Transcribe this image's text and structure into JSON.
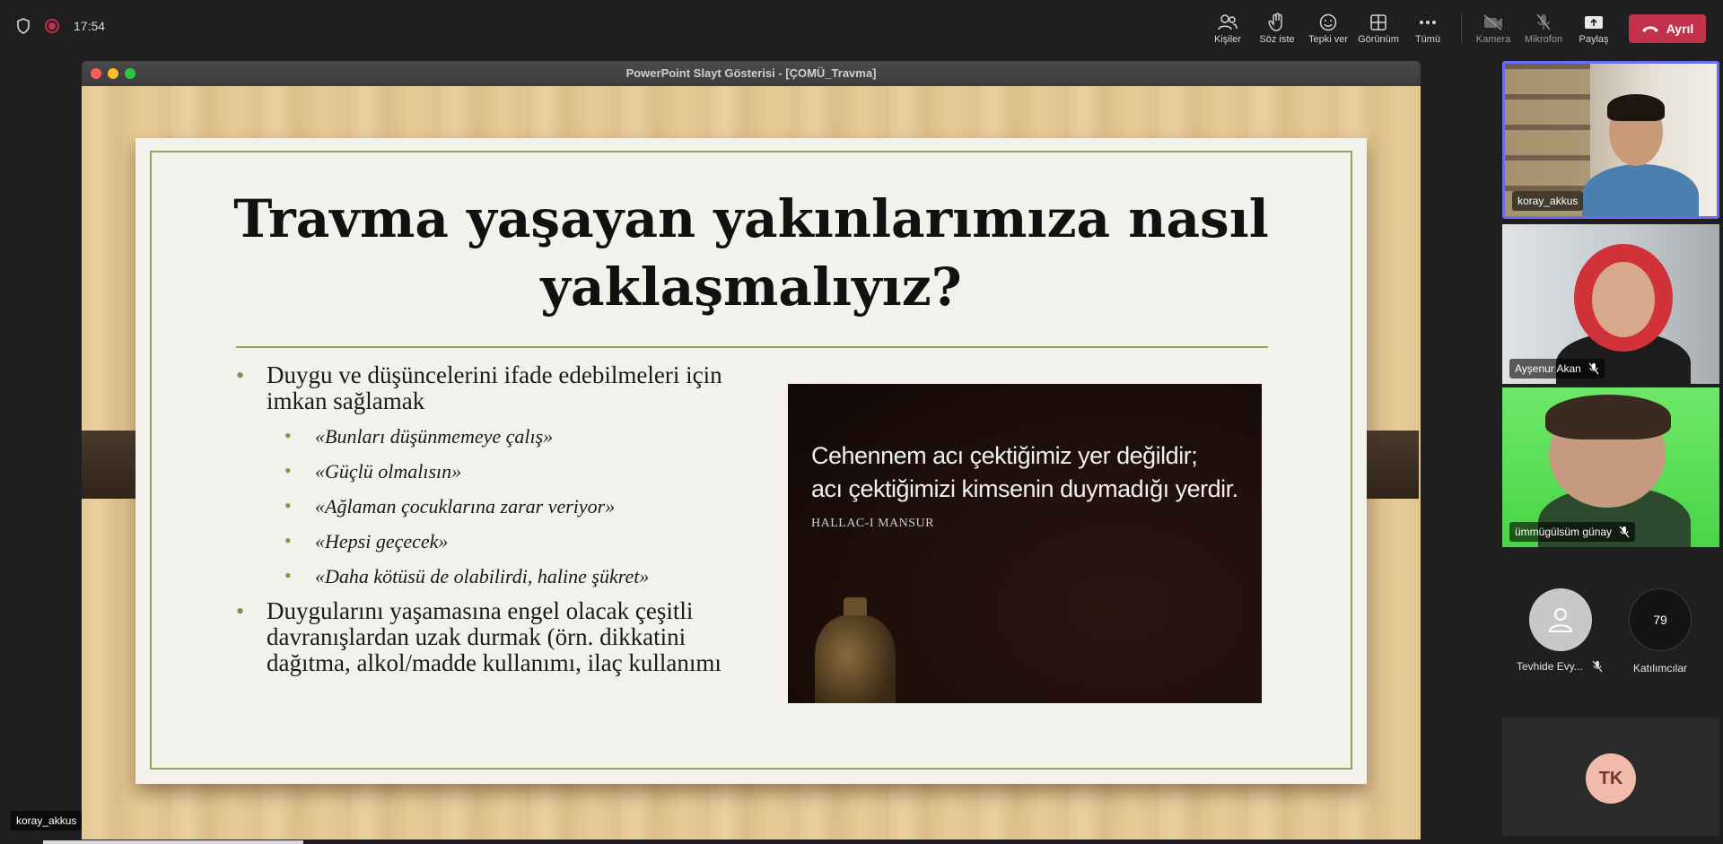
{
  "topbar": {
    "clock": "17:54",
    "buttons": {
      "people": "Kişiler",
      "raise_hand": "Söz iste",
      "react": "Tepki ver",
      "view": "Görünüm",
      "more": "Tümü",
      "camera": "Kamera",
      "mic": "Mikrofon",
      "share": "Paylaş"
    },
    "leave_label": "Ayrıl"
  },
  "shared_window": {
    "title": "PowerPoint Slayt Gösterisi - [ÇOMÜ_Travma]",
    "slide": {
      "title_line1": "Travma yaşayan yakınlarımıza nasıl",
      "title_line2": "yaklaşmalıyız?",
      "bullet1": "Duygu ve düşüncelerini ifade edebilmeleri için imkan sağlamak",
      "sub_bullets": [
        "«Bunları düşünmemeye çalış»",
        "«Güçlü olmalısın»",
        "«Ağlaman çocuklarına zarar veriyor»",
        "«Hepsi geçecek»",
        "«Daha kötüsü de olabilirdi, haline şükret»"
      ],
      "bullet2": "Duygularını yaşamasına engel olacak çeşitli davranışlardan uzak durmak (örn. dikkatini dağıtma, alkol/madde kullanımı, ilaç kullanımı",
      "quote_line1": "Cehennem acı çektiğimiz yer değildir;",
      "quote_line2": "acı çektiğimizi kimsenin duymadığı yerdir.",
      "quote_author": "HALLAC-I MANSUR"
    }
  },
  "presenter_tag": "koray_akkus",
  "participants": {
    "tile1_name": "koray_akkus",
    "tile2_name": "Ayşenur Akan",
    "tile3_name": "ümmügülsüm günay",
    "avatar_name": "Tevhide Evy...",
    "participant_count": "79",
    "participants_label": "Katılımcılar",
    "initials": "TK"
  },
  "colors": {
    "leave": "#c4314b",
    "active_speaker_border": "#6b6ef0",
    "slide_accent": "#9aa05e"
  }
}
